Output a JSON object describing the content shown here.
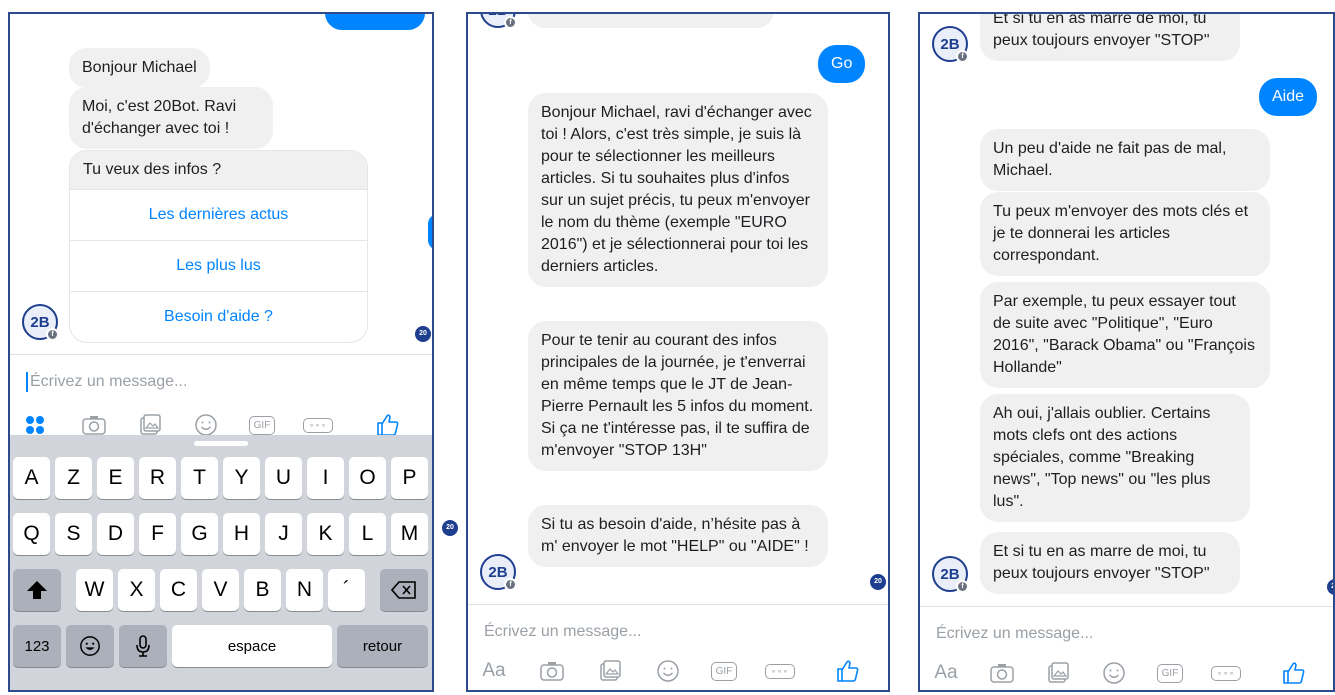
{
  "screens": [
    {
      "bot_messages": [
        "Bonjour Michael",
        "Moi, c'est 20Bot. Ravi d'échanger avec toi !"
      ],
      "card": {
        "header": "Tu veux des infos ?",
        "options": [
          "Les dernières actus",
          "Les plus lus",
          "Besoin d'aide ?"
        ]
      },
      "composer_placeholder": "Écrivez un message...",
      "keyboard": {
        "row1": [
          "A",
          "Z",
          "E",
          "R",
          "T",
          "Y",
          "U",
          "I",
          "O",
          "P"
        ],
        "row2": [
          "Q",
          "S",
          "D",
          "F",
          "G",
          "H",
          "J",
          "K",
          "L",
          "M"
        ],
        "row3": [
          "W",
          "X",
          "C",
          "V",
          "B",
          "N",
          "´"
        ],
        "numbers_key": "123",
        "space_key": "espace",
        "return_key": "retour"
      }
    },
    {
      "user_message": "Go",
      "bot_messages": [
        "Bonjour Michael, ravi d'échanger avec toi ! Alors, c'est très simple, je suis là pour te sélectionner les meilleurs articles. Si tu souhaites plus d'infos sur un sujet précis, tu peux m'envoyer le nom du thème (exemple \"EURO 2016\") et je sélectionnerai pour toi les derniers articles.",
        "Pour te tenir au courant des infos principales de la journée, je t'enverrai en même temps que le JT de Jean-Pierre Pernault les 5 infos du moment. Si ça ne t'intéresse pas, il te suffira de m'envoyer \"STOP 13H\"",
        "Si tu as besoin d'aide, n’hésite pas à m' envoyer le mot \"HELP\" ou \"AIDE\" !"
      ],
      "composer_placeholder": "Écrivez un message...",
      "text_tool": "Aa"
    },
    {
      "top_message": "Et si tu en as marre de moi, tu peux toujours envoyer \"STOP\"",
      "user_message": "Aide",
      "bot_messages": [
        "Un peu d'aide ne fait pas de mal, Michael.",
        "Tu peux m'envoyer des mots clés et je te donnerai les articles correspondant.",
        "Par exemple, tu peux essayer tout de suite avec \"Politique\", \"Euro 2016\", \"Barack Obama\" ou \"François Hollande\"",
        "Ah oui, j'allais oublier. Certains mots clefs ont des actions spéciales, comme \"Breaking news\", \"Top news\" ou \"les plus lus\".",
        "Et si tu en as marre de moi, tu peux toujours envoyer \"STOP\""
      ],
      "composer_placeholder": "Écrivez un message...",
      "text_tool": "Aa"
    }
  ],
  "icons": {
    "avatar": "20bot-avatar-icon",
    "camera": "camera-icon",
    "gallery": "gallery-icon",
    "emoji": "emoji-icon",
    "gif": "gif-icon",
    "more": "more-icon",
    "like": "thumbs-up-icon"
  },
  "gif_label": "GIF",
  "colors": {
    "accent": "#0084ff",
    "bubble": "#f1f0f0",
    "keyboard": "#d1d4da"
  }
}
